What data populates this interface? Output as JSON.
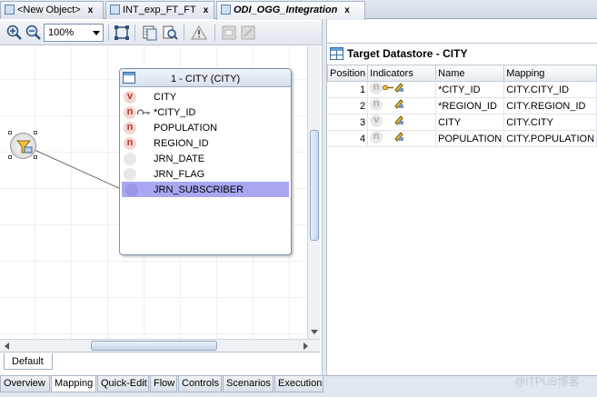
{
  "editor_tabs": [
    {
      "label": "<New Object>",
      "active": false
    },
    {
      "label": "INT_exp_FT_FT",
      "active": false
    },
    {
      "label": "ODI_OGG_Integration",
      "active": true
    }
  ],
  "toolbar": {
    "zoom_value": "100%",
    "buttons": [
      "zoom-in-icon",
      "zoom-out-icon",
      "fit-to-window-icon",
      "layout-icon",
      "search-icon",
      "warning-icon",
      "disabled-icon-1",
      "disabled-icon-2"
    ]
  },
  "diagram": {
    "datastore_title": "1 - CITY (CITY)",
    "attributes": [
      {
        "label": "CITY",
        "badge": "v"
      },
      {
        "label": "*CITY_ID",
        "badge": "n"
      },
      {
        "label": "POPULATION",
        "badge": "n"
      },
      {
        "label": "REGION_ID",
        "badge": "n"
      },
      {
        "label": "JRN_DATE",
        "badge": ""
      },
      {
        "label": "JRN_FLAG",
        "badge": ""
      },
      {
        "label": "JRN_SUBSCRIBER",
        "badge": "",
        "selected": true
      }
    ],
    "bottom_tab": "Default"
  },
  "target_panel": {
    "title": "Target Datastore - CITY",
    "columns": [
      "Position",
      "Indicators",
      "Name",
      "Mapping"
    ],
    "rows": [
      {
        "position": "1",
        "indicator": "n",
        "name": "*CITY_ID",
        "mapping": "CITY.CITY_ID",
        "key": true
      },
      {
        "position": "2",
        "indicator": "n",
        "name": "*REGION_ID",
        "mapping": "CITY.REGION_ID",
        "key": false
      },
      {
        "position": "3",
        "indicator": "v",
        "name": "CITY",
        "mapping": "CITY.CITY",
        "key": false
      },
      {
        "position": "4",
        "indicator": "n",
        "name": "POPULATION",
        "mapping": "CITY.POPULATION",
        "key": false
      }
    ]
  },
  "bottom_tabs": [
    "Overview",
    "Mapping",
    "Quick-Edit",
    "Flow",
    "Controls",
    "Scenarios",
    "Execution"
  ],
  "active_bottom_tab": "Mapping",
  "watermark": "@ITPUB博客"
}
